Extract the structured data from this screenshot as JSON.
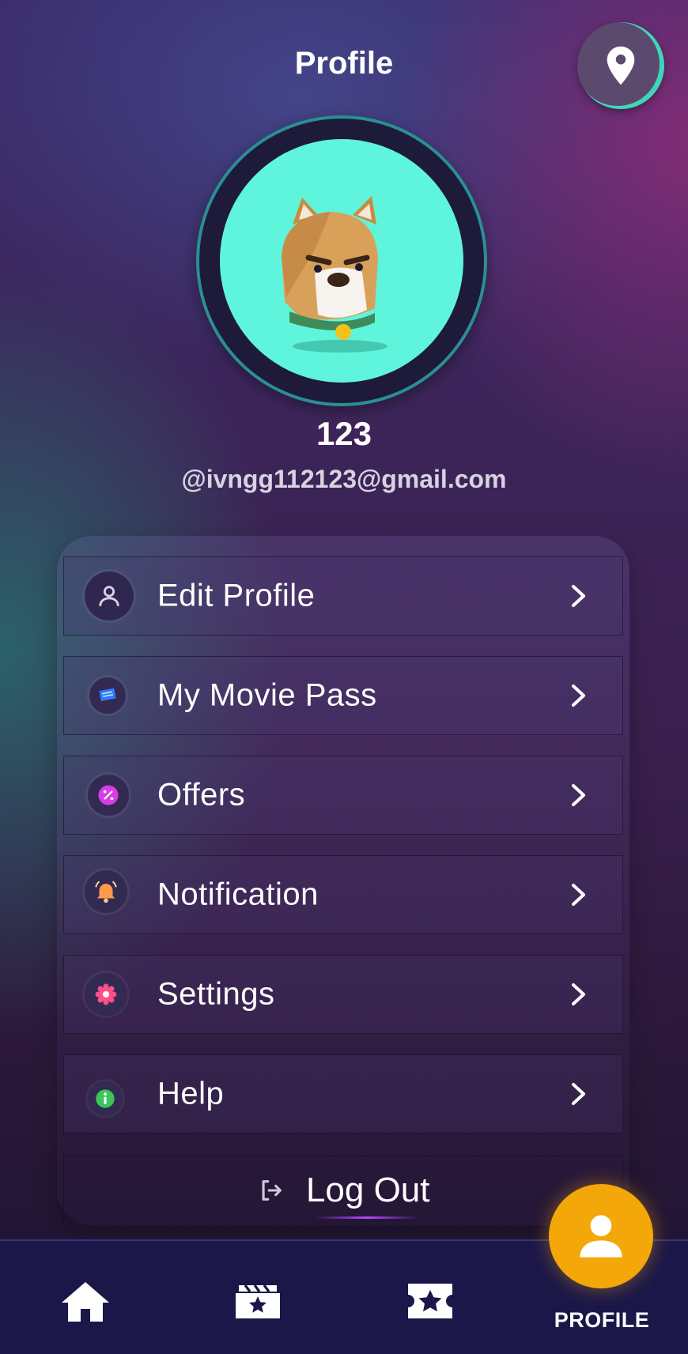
{
  "header": {
    "title": "Profile"
  },
  "user": {
    "name": "123",
    "email": "@ivngg112123@gmail.com"
  },
  "menu": [
    {
      "label": "Edit Profile",
      "icon": "user-icon"
    },
    {
      "label": "My Movie Pass",
      "icon": "ticket-icon"
    },
    {
      "label": "Offers",
      "icon": "percent-icon"
    },
    {
      "label": "Notification",
      "icon": "bell-icon"
    },
    {
      "label": "Settings",
      "icon": "gear-icon"
    },
    {
      "label": "Help",
      "icon": "info-icon"
    }
  ],
  "logout": {
    "label": "Log Out"
  },
  "nav": {
    "items": [
      "home-icon",
      "movies-icon",
      "favorites-icon",
      "profile-icon"
    ],
    "active_label": "PROFILE"
  },
  "colors": {
    "accent": "#f4a708",
    "avatar_bg": "#5ff5dc",
    "ring": "#3fd6b8",
    "navbar": "#1b1748"
  }
}
